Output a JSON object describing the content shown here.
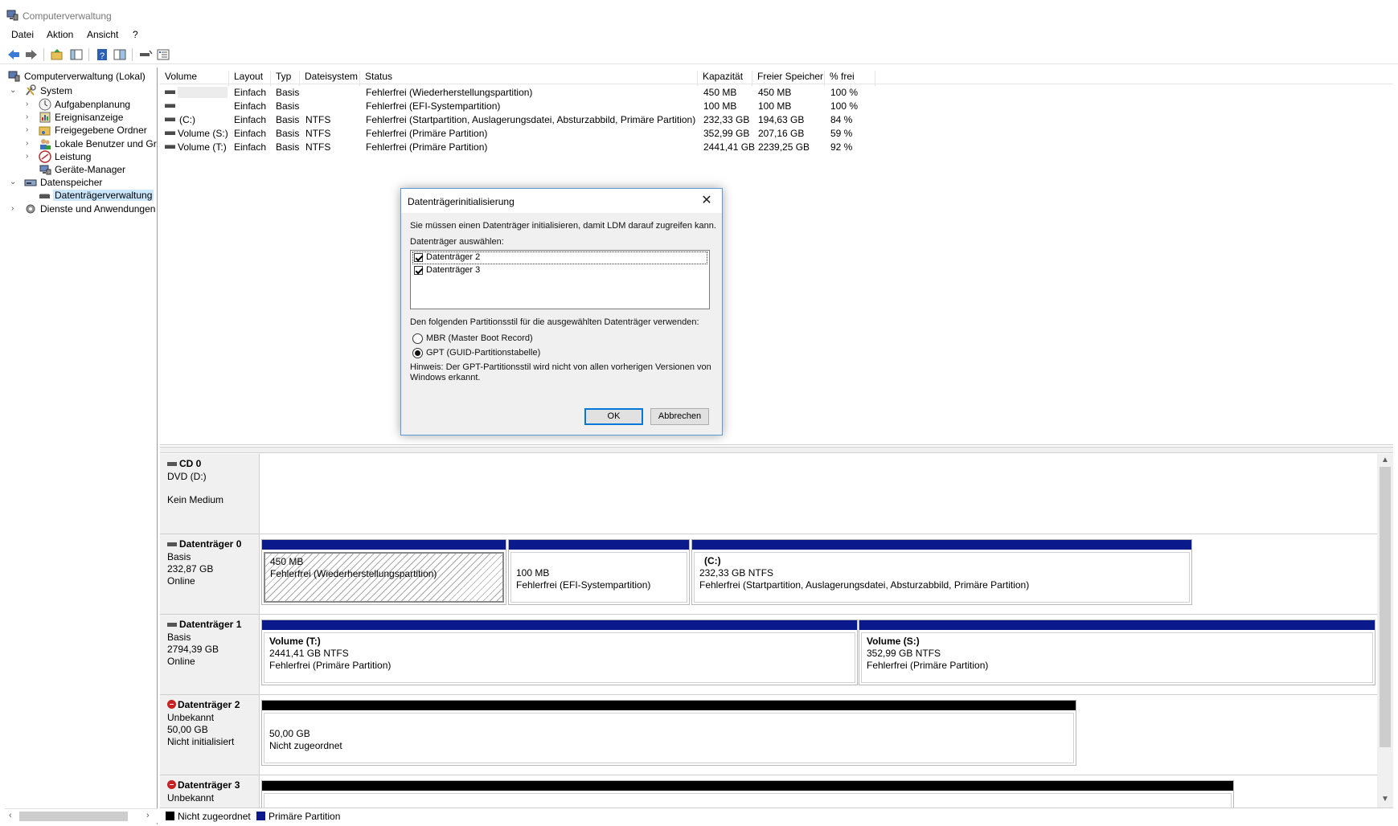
{
  "window": {
    "title": "Computerverwaltung"
  },
  "menu": {
    "items": [
      "Datei",
      "Aktion",
      "Ansicht",
      "?"
    ]
  },
  "tree": {
    "items": [
      {
        "label": "Computerverwaltung (Lokal)",
        "icon": "computer-management-icon"
      },
      {
        "label": "System",
        "icon": "system-tools-icon"
      },
      {
        "label": "Aufgabenplanung",
        "icon": "clock-icon"
      },
      {
        "label": "Ereignisanzeige",
        "icon": "event-viewer-icon"
      },
      {
        "label": "Freigegebene Ordner",
        "icon": "shared-folder-icon"
      },
      {
        "label": "Lokale Benutzer und Gruppen",
        "icon": "users-icon"
      },
      {
        "label": "Leistung",
        "icon": "performance-icon"
      },
      {
        "label": "Geräte-Manager",
        "icon": "device-manager-icon"
      },
      {
        "label": "Datenspeicher",
        "icon": "storage-icon"
      },
      {
        "label": "Datenträgerverwaltung",
        "icon": "disk-management-icon"
      },
      {
        "label": "Dienste und Anwendungen",
        "icon": "services-icon"
      }
    ]
  },
  "volumes": {
    "columns": [
      "Volume",
      "Layout",
      "Typ",
      "Dateisystem",
      "Status",
      "Kapazität",
      "Freier Speicher",
      "% frei"
    ],
    "rows": [
      {
        "volume": "",
        "layout": "Einfach",
        "type": "Basis",
        "fs": "",
        "status": "Fehlerfrei (Wiederherstellungspartition)",
        "capacity": "450 MB",
        "free": "450 MB",
        "pct": "100 %"
      },
      {
        "volume": "",
        "layout": "Einfach",
        "type": "Basis",
        "fs": "",
        "status": "Fehlerfrei (EFI-Systempartition)",
        "capacity": "100 MB",
        "free": "100 MB",
        "pct": "100 %"
      },
      {
        "volume": "(C:)",
        "layout": "Einfach",
        "type": "Basis",
        "fs": "NTFS",
        "status": "Fehlerfrei (Startpartition, Auslagerungsdatei, Absturzabbild, Primäre Partition)",
        "capacity": "232,33 GB",
        "free": "194,63 GB",
        "pct": "84 %"
      },
      {
        "volume": "Volume (S:)",
        "layout": "Einfach",
        "type": "Basis",
        "fs": "NTFS",
        "status": "Fehlerfrei (Primäre Partition)",
        "capacity": "352,99 GB",
        "free": "207,16 GB",
        "pct": "59 %"
      },
      {
        "volume": "Volume (T:)",
        "layout": "Einfach",
        "type": "Basis",
        "fs": "NTFS",
        "status": "Fehlerfrei (Primäre Partition)",
        "capacity": "2441,41 GB",
        "free": "2239,25 GB",
        "pct": "92 %"
      }
    ]
  },
  "disks": {
    "cd0": {
      "name": "CD 0",
      "line1": "DVD (D:)",
      "line2": "Kein Medium"
    },
    "disk0": {
      "name": "Datenträger 0",
      "line1": "Basis",
      "line2": "232,87 GB",
      "line3": "Online",
      "parts": [
        {
          "title": "",
          "size": "450 MB",
          "status": "Fehlerfrei (Wiederherstellungspartition)"
        },
        {
          "title": "",
          "size": "100 MB",
          "status": "Fehlerfrei (EFI-Systempartition)"
        },
        {
          "title": "(C:)",
          "size": "232,33 GB NTFS",
          "status": "Fehlerfrei (Startpartition, Auslagerungsdatei, Absturzabbild, Primäre Partition)"
        }
      ]
    },
    "disk1": {
      "name": "Datenträger 1",
      "line1": "Basis",
      "line2": "2794,39 GB",
      "line3": "Online",
      "parts": [
        {
          "title": "Volume  (T:)",
          "size": "2441,41 GB NTFS",
          "status": "Fehlerfrei (Primäre Partition)"
        },
        {
          "title": "Volume  (S:)",
          "size": "352,99 GB NTFS",
          "status": "Fehlerfrei (Primäre Partition)"
        }
      ]
    },
    "disk2": {
      "name": "Datenträger 2",
      "line1": "Unbekannt",
      "line2": "50,00 GB",
      "line3": "Nicht initialisiert",
      "parts": [
        {
          "size": "50,00 GB",
          "status": "Nicht zugeordnet"
        }
      ]
    },
    "disk3": {
      "name": "Datenträger 3",
      "line1": "Unbekannt"
    }
  },
  "legend": {
    "unallocated": "Nicht zugeordnet",
    "primary": "Primäre Partition",
    "unallocated_color": "#000000",
    "primary_color": "#0a1a8c"
  },
  "dialog": {
    "title": "Datenträgerinitialisierung",
    "intro": "Sie müssen einen Datenträger initialisieren, damit LDM darauf zugreifen kann.",
    "select_label": "Datenträger auswählen:",
    "disks": [
      "Datenträger 2",
      "Datenträger 3"
    ],
    "style_label": "Den folgenden Partitionsstil für die ausgewählten Datenträger verwenden:",
    "option_mbr": "MBR (Master Boot Record)",
    "option_gpt": "GPT (GUID-Partitionstabelle)",
    "selected_option": "GPT (GUID-Partitionstabelle)",
    "note_line1": "Hinweis: Der GPT-Partitionsstil wird nicht von allen vorherigen Versionen von",
    "note_line2": "Windows erkannt.",
    "ok": "OK",
    "cancel": "Abbrechen"
  }
}
